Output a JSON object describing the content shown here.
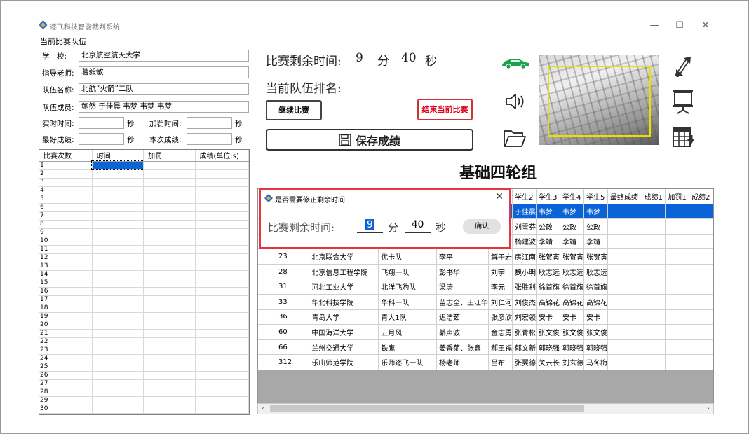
{
  "app": {
    "title": "逐飞科技智能裁判系统"
  },
  "window_controls": {
    "minimize": "—",
    "maximize": "☐",
    "close": "✕"
  },
  "team": {
    "group_title": "当前比赛队伍",
    "school_label": "学　校:",
    "school": "北京航空航天大学",
    "teacher_label": "指导老师:",
    "teacher": "葛毅敏",
    "team_name_label": "队伍名称:",
    "team_name": "北航“火箭”二队",
    "members_label": "队伍成员:",
    "members": "鲍然 于佳晨 韦梦 韦梦 韦梦",
    "realtime_label": "实时时间:",
    "realtime_value": "",
    "sec1": "秒",
    "penalty_label": "加罚时间:",
    "penalty_value": "",
    "sec2": "秒",
    "best_label": "最好成绩:",
    "best_value": "",
    "sec3": "秒",
    "current_label": "本次成绩:",
    "current_value": "",
    "sec4": "秒"
  },
  "left_grid": {
    "headers": [
      "比赛次数",
      "时间",
      "加罚",
      "成绩(单位:s)"
    ],
    "rows": [
      "1",
      "2",
      "3",
      "4",
      "5",
      "6",
      "7",
      "8",
      "9",
      "10",
      "11",
      "12",
      "13",
      "14",
      "15",
      "16",
      "17",
      "18",
      "19",
      "20",
      "21",
      "22",
      "23",
      "24",
      "25",
      "26",
      "27",
      "28",
      "29",
      "30"
    ]
  },
  "main": {
    "remaining_label": "比赛剩余时间:",
    "minutes": "9",
    "min_unit": "分",
    "seconds": "40",
    "sec_unit": "秒",
    "rank_label": "当前队伍排名:",
    "continue_button": "继续比赛",
    "end_button": "结束当前比赛",
    "save_button": "保存成绩",
    "group_name": "基础四轮组"
  },
  "icons": {
    "car": "car-icon",
    "speaker": "speaker-icon",
    "folder": "folder-icon",
    "resize": "resize-icon",
    "presentation": "presentation-icon",
    "export": "table-export-icon"
  },
  "dialog": {
    "title": "是否需要修正剩余时间",
    "label": "比赛剩余时间:",
    "minutes": "9",
    "min_unit": "分",
    "seconds": "40",
    "sec_unit": "秒",
    "ok_button": "确认",
    "close": "✕"
  },
  "results_grid": {
    "headers": [
      "",
      "",
      "",
      "",
      "",
      "学生2",
      "学生3",
      "学生4",
      "学生5",
      "最终成绩",
      "成绩1",
      "加罚1",
      "成绩2"
    ],
    "rows": [
      [
        "",
        "",
        "",
        "",
        "",
        "于佳晨",
        "韦梦",
        "韦梦",
        "韦梦",
        "",
        "",
        "",
        ""
      ],
      [
        "",
        "",
        "",
        "",
        "",
        "刘雪芬",
        "公政",
        "公政",
        "公政",
        "",
        "",
        "",
        ""
      ],
      [
        "",
        "",
        "",
        "",
        "",
        "杨建波",
        "李靖",
        "李靖",
        "李靖",
        "",
        "",
        "",
        ""
      ],
      [
        "23",
        "北京联合大学",
        "优卡队",
        "李平",
        "解子岩",
        "房江南",
        "张贺寅",
        "张贺寅",
        "张贺寅",
        "",
        "",
        "",
        ""
      ],
      [
        "28",
        "北京信息工程学院",
        "飞翔一队",
        "彭书华",
        "刘宇",
        "魏小明",
        "耿志远",
        "耿志远",
        "耿志远",
        "",
        "",
        "",
        ""
      ],
      [
        "31",
        "河北工业大学",
        "北洋飞豹队",
        "梁涛",
        "李元",
        "张胜利",
        "徐首旗",
        "徐首旗",
        "徐首旗",
        "",
        "",
        "",
        ""
      ],
      [
        "33",
        "华北科技学院",
        "华科一队",
        "苗志全、王江华",
        "刘仁河",
        "刘俊杰",
        "高锦花",
        "高锦花",
        "高锦花",
        "",
        "",
        "",
        ""
      ],
      [
        "36",
        "青岛大学",
        "青大1队",
        "迟洁茹",
        "张彦欣",
        "刘宏领",
        "安卡",
        "安卡",
        "安卡",
        "",
        "",
        "",
        ""
      ],
      [
        "60",
        "中国海洋大学",
        "五月风",
        "綦声波",
        "金志勇",
        "张青松",
        "张文俊",
        "张文俊",
        "张文俊",
        "",
        "",
        "",
        ""
      ],
      [
        "66",
        "兰州交通大学",
        "铁鹰",
        "姜香菊、张鑫",
        "郝王福",
        "郁文新",
        "郭晓强",
        "郭晓强",
        "郭晓强",
        "",
        "",
        "",
        ""
      ],
      [
        "312",
        "乐山师范学院",
        "乐师逐飞一队",
        "杨老师",
        "吕布",
        "张翼德",
        "关云长",
        "刘玄德",
        "马冬梅",
        "",
        "",
        "",
        ""
      ]
    ]
  },
  "scroll": {
    "left": "‹",
    "right": "›"
  },
  "colors": {
    "selection": "#0a64d8",
    "dialog_border": "#e8343f",
    "end_button": "#e0001b",
    "car": "#1aa34a",
    "cam_box": "#e8e000"
  }
}
